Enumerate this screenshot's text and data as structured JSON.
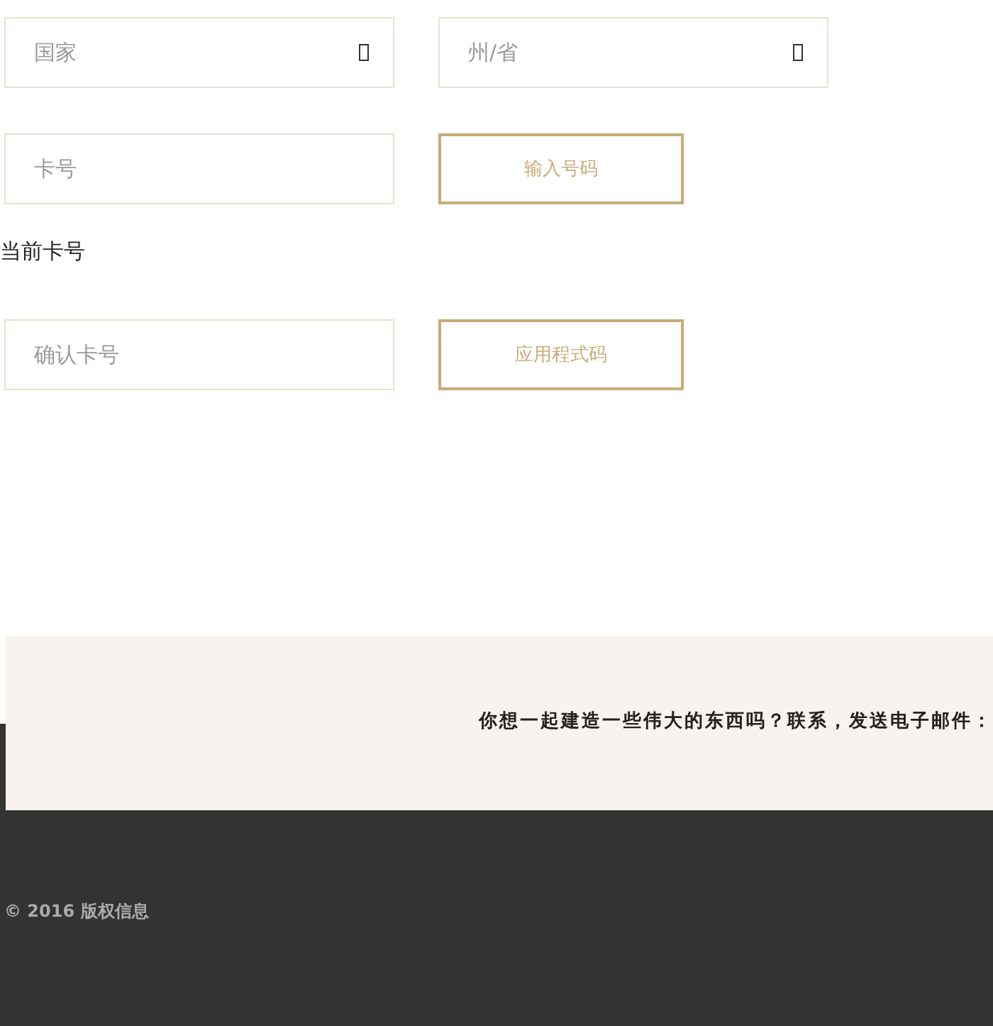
{
  "form": {
    "rows": [
      {
        "kind": "selects",
        "fields": [
          {
            "placeholder": "国家"
          },
          {
            "placeholder": "州/省"
          }
        ]
      },
      {
        "kind": "field_button",
        "field": {
          "placeholder": "卡号"
        },
        "button": "输入号码"
      },
      {
        "kind": "label",
        "text": "当前卡号"
      },
      {
        "kind": "field_button",
        "field": {
          "placeholder": "确认卡号"
        },
        "button": "应用程式码"
      }
    ]
  },
  "contact": {
    "text": "你想一起建造一些伟大的东西吗？联系，发送电子邮件："
  },
  "footer": {
    "copyright": "© 2016 版权信息"
  }
}
